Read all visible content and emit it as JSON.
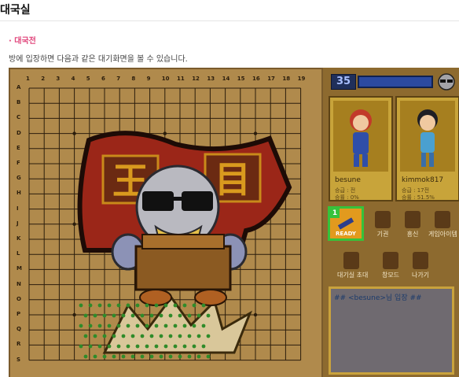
{
  "page": {
    "title": "대국실",
    "section_label": "· 대국전",
    "description": "방에 입장하면 다음과 같은 대기화면을 볼 수 있습니다."
  },
  "board": {
    "columns": [
      "1",
      "2",
      "3",
      "4",
      "5",
      "6",
      "7",
      "8",
      "9",
      "10",
      "11",
      "12",
      "13",
      "14",
      "15",
      "16",
      "17",
      "18",
      "19"
    ],
    "rows": [
      "A",
      "B",
      "C",
      "D",
      "E",
      "F",
      "G",
      "H",
      "I",
      "J",
      "K",
      "L",
      "M",
      "N",
      "O",
      "P",
      "Q",
      "R",
      "S"
    ],
    "banner_left_char": "王",
    "banner_right_char": "目"
  },
  "side_panel": {
    "timer": "35",
    "players": [
      {
        "name": "besune",
        "stat1": "승급 : 전",
        "stat2": "승률 : 0%"
      },
      {
        "name": "kimmok817",
        "stat1": "승급 : 17전",
        "stat2": "승률 : 51.5%"
      }
    ],
    "ready": {
      "badge": "1",
      "label": "READY"
    },
    "tools": [
      {
        "label": "기권",
        "icon": "flag-icon"
      },
      {
        "label": "흥신",
        "icon": "person-icon"
      },
      {
        "label": "게임아이템",
        "icon": "money-bag-icon"
      },
      {
        "label": "대기실 초대",
        "icon": "invite-icon"
      },
      {
        "label": "창모드",
        "icon": "window-mode-icon"
      },
      {
        "label": "나가기",
        "icon": "exit-icon"
      }
    ],
    "chat_message": "## <besune>님 입장 ##"
  },
  "colors": {
    "accent_pink": "#e0457b",
    "ready_green": "#36c23b",
    "ready_orange": "#e29a1e"
  }
}
